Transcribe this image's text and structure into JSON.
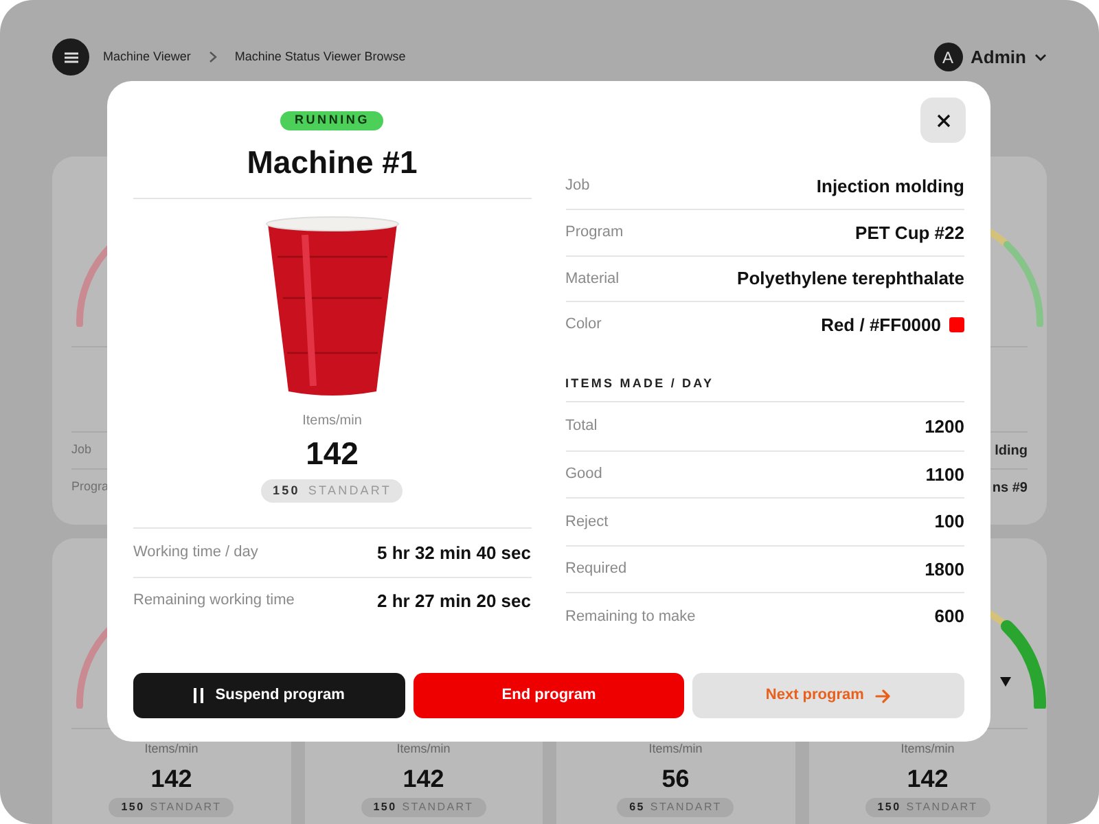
{
  "header": {
    "breadcrumbs": [
      "Machine Viewer",
      "Machine Status Viewer Browse"
    ],
    "user": {
      "initial": "A",
      "name": "Admin"
    }
  },
  "background": {
    "top_left_card": {
      "rows": [
        {
          "label": "Job"
        },
        {
          "label": "Progra"
        }
      ]
    },
    "top_right_card": {
      "rows": [
        {
          "value": "lding"
        },
        {
          "value": "ns #9"
        }
      ]
    },
    "bottom_cards": [
      {
        "rate_label": "Items/min",
        "rate": "142",
        "standard_value": "150",
        "standard_label": "STANDART"
      },
      {
        "rate_label": "Items/min",
        "rate": "142",
        "standard_value": "150",
        "standard_label": "STANDART"
      },
      {
        "rate_label": "Items/min",
        "rate": "56",
        "standard_value": "65",
        "standard_label": "STANDART"
      },
      {
        "rate_label": "Items/min",
        "rate": "142",
        "standard_value": "150",
        "standard_label": "STANDART"
      }
    ]
  },
  "dialog": {
    "status": {
      "label": "RUNNING",
      "kind": "running"
    },
    "title": "Machine #1",
    "rate_label": "Items/min",
    "rate": "142",
    "standard_value": "150",
    "standard_label": "STANDART",
    "times": [
      {
        "label": "Working time / day",
        "value": "5 hr 32 min 40 sec"
      },
      {
        "label": "Remaining working time",
        "value": "2 hr 27 min 20 sec"
      }
    ],
    "details": [
      {
        "label": "Job",
        "value": "Injection molding"
      },
      {
        "label": "Program",
        "value": "PET Cup #22"
      },
      {
        "label": "Material",
        "value": "Polyethylene terephthalate"
      },
      {
        "label": "Color",
        "value": "Red / #FF0000",
        "color": "#ff0000"
      }
    ],
    "items_heading": "ITEMS MADE / DAY",
    "items": [
      {
        "label": "Total",
        "value": "1200"
      },
      {
        "label": "Good",
        "value": "1100"
      },
      {
        "label": "Reject",
        "value": "100"
      },
      {
        "label": "Required",
        "value": "1800"
      },
      {
        "label": "Remaining to make",
        "value": "600"
      }
    ],
    "buttons": [
      {
        "label": "Suspend program",
        "kind": "dark"
      },
      {
        "label": "End program",
        "kind": "danger"
      },
      {
        "label": "Next program",
        "kind": "light"
      }
    ]
  }
}
